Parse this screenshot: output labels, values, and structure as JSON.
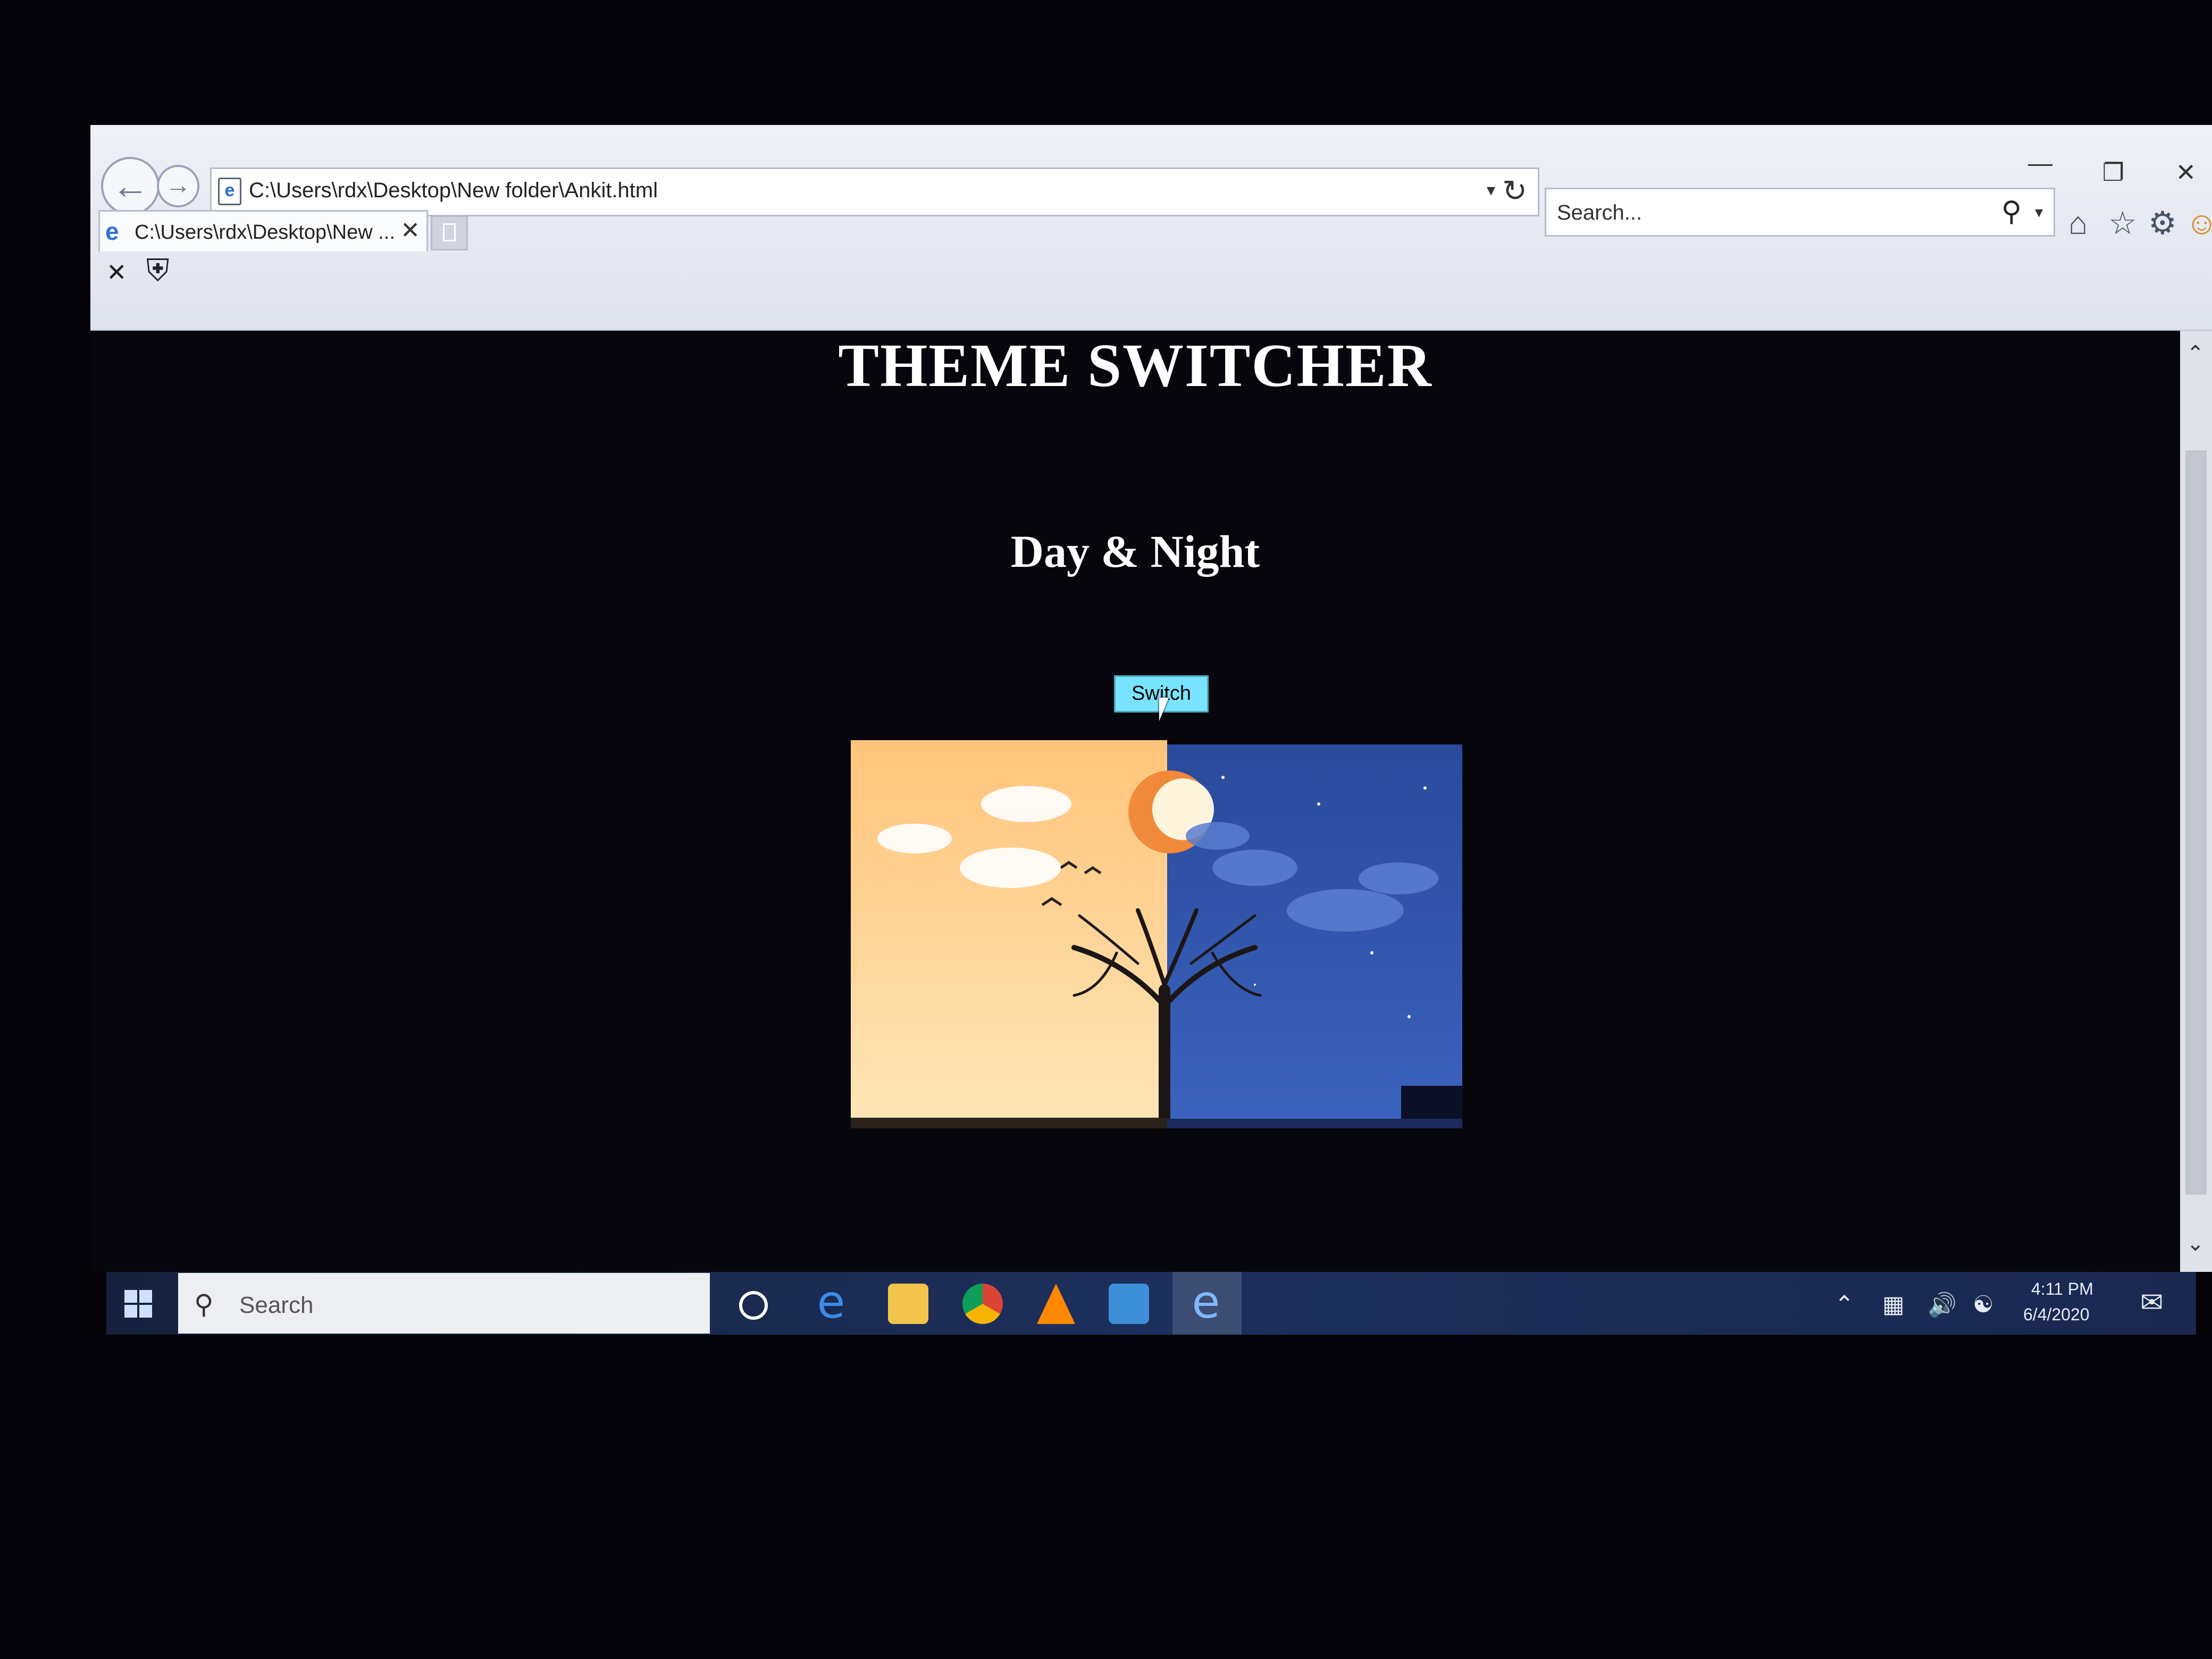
{
  "browser": {
    "address": "C:\\Users\\rdx\\Desktop\\New folder\\Ankit.html",
    "search_placeholder": "Search...",
    "tab_title": "C:\\Users\\rdx\\Desktop\\New ...",
    "icons": {
      "back": "back-arrow-icon",
      "forward": "forward-arrow-icon",
      "refresh": "refresh-icon",
      "home": "home-icon",
      "favorites": "star-icon",
      "settings": "gear-icon",
      "feedback": "smiley-icon"
    }
  },
  "page": {
    "title": "THEME SWITCHER",
    "subtitle": "Day & Night",
    "switch_button": "Switch",
    "background_color": "#06060c",
    "button_color": "#79e4ff"
  },
  "taskbar": {
    "search_placeholder": "Search",
    "time": "4:11 PM",
    "date": "6/4/2020",
    "apps": [
      "cortana",
      "edge",
      "file-explorer",
      "chrome",
      "vlc",
      "mail",
      "internet-explorer"
    ],
    "active_app": "internet-explorer"
  }
}
